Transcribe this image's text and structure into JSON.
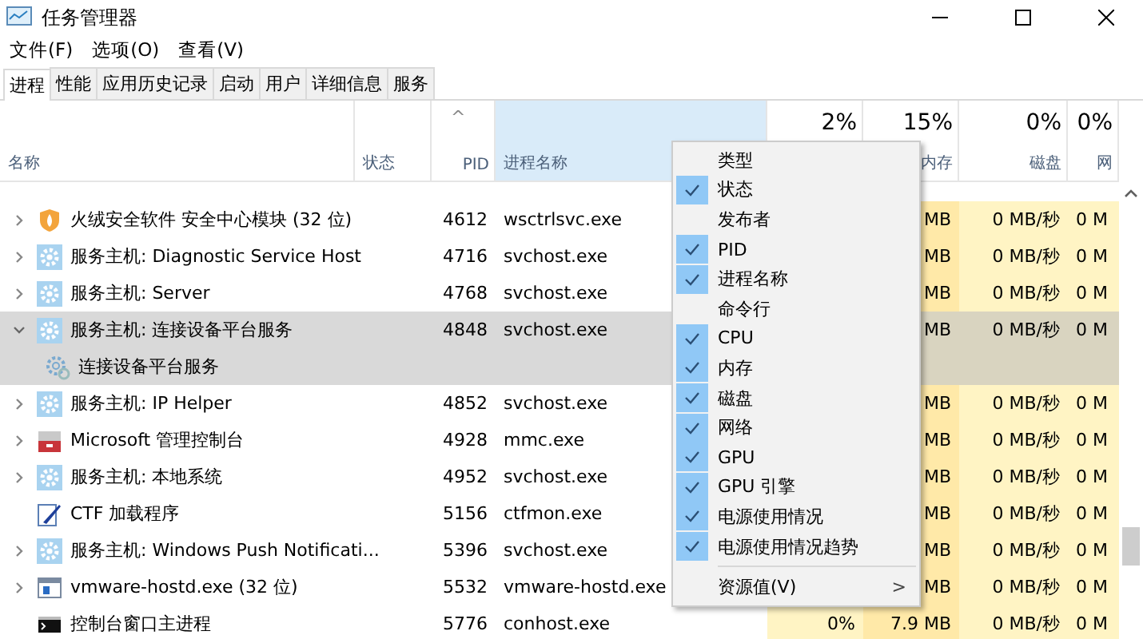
{
  "window": {
    "title": "任务管理器"
  },
  "menubar": [
    "文件(F)",
    "选项(O)",
    "查看(V)"
  ],
  "tabs": [
    {
      "label": "进程",
      "selected": true
    },
    {
      "label": "性能",
      "selected": false
    },
    {
      "label": "应用历史记录",
      "selected": false
    },
    {
      "label": "启动",
      "selected": false
    },
    {
      "label": "用户",
      "selected": false
    },
    {
      "label": "详细信息",
      "selected": false
    },
    {
      "label": "服务",
      "selected": false
    }
  ],
  "table": {
    "columns": [
      {
        "label": "名称"
      },
      {
        "label": "状态"
      },
      {
        "label": "PID",
        "sort": "^"
      },
      {
        "label": "进程名称",
        "hovered": true
      },
      {
        "percent": "2%"
      },
      {
        "percent": "15%",
        "label": "内存"
      },
      {
        "percent": "0%",
        "label": "磁盘"
      },
      {
        "percent": "0%",
        "label": "网"
      }
    ],
    "rows": [
      {
        "kind": "shield",
        "name": "火绒安全软件 安全中心模块 (32 位)",
        "pid": "4612",
        "process": "wsctrlsvc.exe",
        "memory": "MB",
        "disk": "0 MB/秒",
        "network": "0 M",
        "expanded": false,
        "selected": false
      },
      {
        "kind": "service",
        "name": "服务主机: Diagnostic Service Host",
        "pid": "4716",
        "process": "svchost.exe",
        "memory": "MB",
        "disk": "0 MB/秒",
        "network": "0 M",
        "expanded": false,
        "selected": false
      },
      {
        "kind": "service",
        "name": "服务主机: Server",
        "pid": "4768",
        "process": "svchost.exe",
        "memory": "MB",
        "disk": "0 MB/秒",
        "network": "0 M",
        "expanded": false,
        "selected": false
      },
      {
        "kind": "service",
        "name": "服务主机: 连接设备平台服务",
        "pid": "4848",
        "process": "svchost.exe",
        "memory": "MB",
        "disk": "0 MB/秒",
        "network": "0 M",
        "expanded": true,
        "selected": true,
        "children": [
          {
            "kind": "service-child",
            "name": "连接设备平台服务"
          }
        ]
      },
      {
        "kind": "service",
        "name": "服务主机: IP Helper",
        "pid": "4852",
        "process": "svchost.exe",
        "memory": "MB",
        "disk": "0 MB/秒",
        "network": "0 M",
        "expanded": false,
        "selected": false
      },
      {
        "kind": "toolbox",
        "name": "Microsoft 管理控制台",
        "pid": "4928",
        "process": "mmc.exe",
        "memory": "MB",
        "disk": "0 MB/秒",
        "network": "0 M",
        "expanded": false,
        "selected": false
      },
      {
        "kind": "service",
        "name": "服务主机: 本地系统",
        "pid": "4952",
        "process": "svchost.exe",
        "memory": "MB",
        "disk": "0 MB/秒",
        "network": "0 M",
        "expanded": false,
        "selected": false
      },
      {
        "kind": "pen",
        "name": "CTF 加载程序",
        "pid": "5156",
        "process": "ctfmon.exe",
        "memory": "MB",
        "disk": "0 MB/秒",
        "network": "0 M",
        "selected": false
      },
      {
        "kind": "service",
        "name": "服务主机: Windows Push Notificati...",
        "pid": "5396",
        "process": "svchost.exe",
        "memory": "MB",
        "disk": "0 MB/秒",
        "network": "0 M",
        "expanded": false,
        "selected": false
      },
      {
        "kind": "vm",
        "name": "vmware-hostd.exe (32 位)",
        "pid": "5532",
        "process": "vmware-hostd.exe",
        "memory": "MB",
        "disk": "0 MB/秒",
        "network": "0 M",
        "expanded": false,
        "selected": false
      },
      {
        "kind": "console",
        "name": "控制台窗口主进程",
        "pid": "5776",
        "process": "conhost.exe",
        "cpu": "0%",
        "memory": "7.9 MB",
        "disk": "0 MB/秒",
        "network": "0 M",
        "selected": false
      }
    ]
  },
  "context_menu": {
    "items": [
      {
        "label": "类型",
        "checked": false
      },
      {
        "label": "状态",
        "checked": true
      },
      {
        "label": "发布者",
        "checked": false
      },
      {
        "label": "PID",
        "checked": true
      },
      {
        "label": "进程名称",
        "checked": true
      },
      {
        "label": "命令行",
        "checked": false
      },
      {
        "label": "CPU",
        "checked": true
      },
      {
        "label": "内存",
        "checked": true
      },
      {
        "label": "磁盘",
        "checked": true
      },
      {
        "label": "网络",
        "checked": true
      },
      {
        "label": "GPU",
        "checked": true
      },
      {
        "label": "GPU 引擎",
        "checked": true
      },
      {
        "label": "电源使用情况",
        "checked": true
      },
      {
        "label": "电源使用情况趋势",
        "checked": true
      }
    ],
    "submenu": {
      "label": "资源值(V)",
      "arrow": ">"
    }
  }
}
